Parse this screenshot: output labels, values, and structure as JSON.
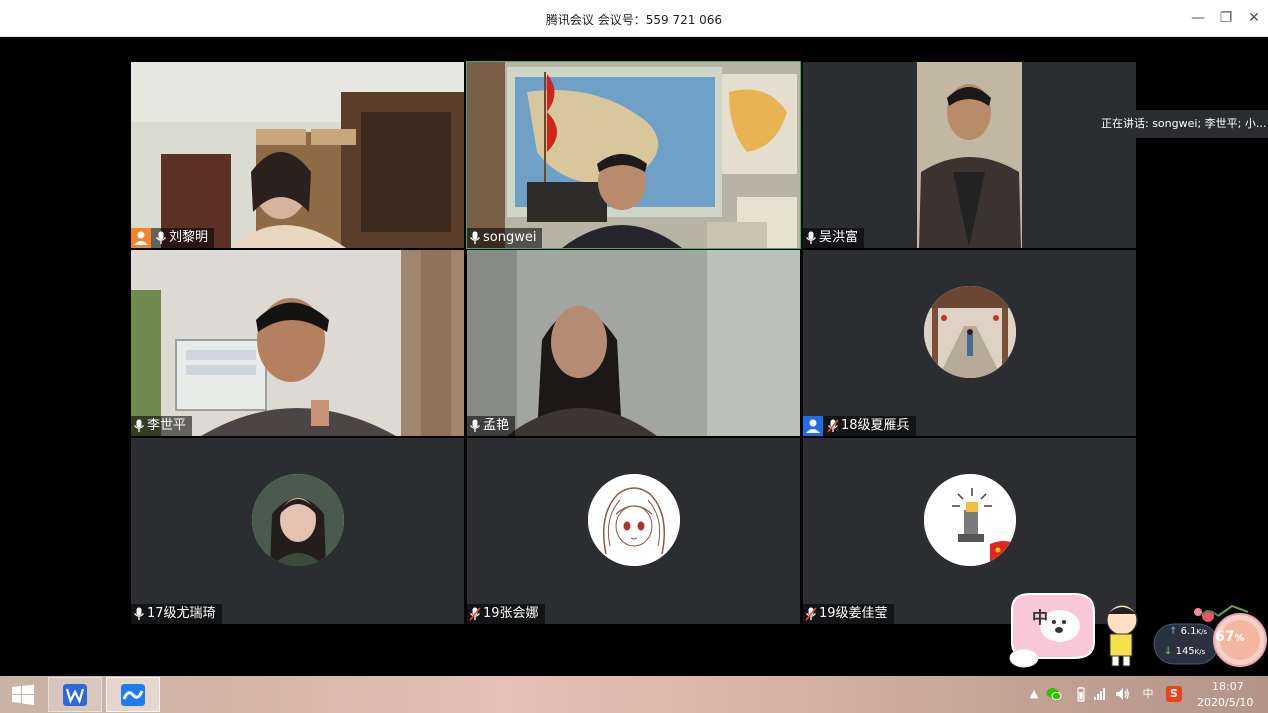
{
  "window": {
    "title": "腾讯会议 会议号：559 721 066",
    "minimize_glyph": "—",
    "restore_glyph": "❐",
    "close_glyph": "✕"
  },
  "speaking_indicator": {
    "text": "正在讲话: songwei; 李世平; 小..."
  },
  "participants": [
    {
      "name": "刘黎明",
      "mic": "mic-on-icon",
      "role": "host-icon",
      "role_color": "#f5842b",
      "speaking": false
    },
    {
      "name": "songwei",
      "mic": "mic-on-icon",
      "role": null,
      "speaking": true
    },
    {
      "name": "吴洪富",
      "mic": "mic-on-icon",
      "role": null,
      "speaking": false
    },
    {
      "name": "李世平",
      "mic": "mic-on-icon",
      "role": null,
      "speaking": false
    },
    {
      "name": "孟艳",
      "mic": "mic-on-icon",
      "role": null,
      "speaking": false
    },
    {
      "name": "18级夏雁兵",
      "mic": "mic-muted-icon",
      "role": "co-host-icon",
      "role_color": "#1e6fe6",
      "speaking": false
    },
    {
      "name": "17级尤瑞琦",
      "mic": "mic-on-icon",
      "role": null,
      "speaking": false
    },
    {
      "name": "19张会娜",
      "mic": "mic-muted-icon",
      "role": null,
      "speaking": false
    },
    {
      "name": "19级姜佳莹",
      "mic": "mic-muted-icon",
      "role": null,
      "speaking": false
    }
  ],
  "ime_widget": {
    "label": "中"
  },
  "net_monitor": {
    "upload": "6.1",
    "upload_unit": "K/s",
    "download": "145",
    "download_unit": "K/s",
    "percent": "67",
    "percent_suffix": "%"
  },
  "taskbar": {
    "apps": [
      {
        "name": "WPS Office",
        "icon": "wps-icon",
        "color": "#2b6ad8",
        "active": false
      },
      {
        "name": "腾讯会议",
        "icon": "tencent-meeting-icon",
        "color": "#1f7cf0",
        "active": true
      }
    ],
    "tray": {
      "ime_label": "中",
      "sogou_label": "S"
    },
    "clock": {
      "time": "18:07",
      "date": "2020/5/10"
    }
  },
  "colors": {
    "speaking_border": "#2fb36a",
    "tile_bg": "#2b2d31",
    "muted_mic": "#ff3b30"
  }
}
